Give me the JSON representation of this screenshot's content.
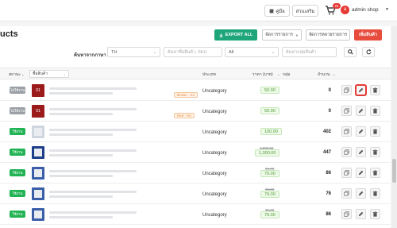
{
  "topbar": {
    "manual_label": "คู่มือ",
    "promo_label": "ส่วนเสริม",
    "cart_count": "24",
    "avatar_letter": "a",
    "user_name": "admin shop"
  },
  "header": {
    "title": "ucts",
    "export_label": "EXPORT ALL",
    "manage_label": "จัดการรายการ",
    "batch_label": "จัดการหลายรายการ",
    "add_label": "เพิ่มสินค้า"
  },
  "filters": {
    "search_label": "ค้นหาจากภาษา",
    "language": "TH",
    "name_placeholder": "ค้นหาชื่อสินค้า, SKU",
    "status": "All",
    "category_placeholder": "ค้นหากลุ่มสินค้า"
  },
  "table": {
    "headers": {
      "status": "สถานะ",
      "name": "ชื่อสินค้า",
      "category": "ประเภท",
      "price": "ราคา (บาท)",
      "group": "กลุ่ม",
      "qty": "จำนวน"
    },
    "rows": [
      {
        "status": "ไม่ใช้งาน",
        "thumb": "01",
        "variant": "Brown - K1",
        "category": "Uncategory",
        "price_old": "",
        "price": "50.00",
        "qty": "0"
      },
      {
        "status": "ไม่ใช้งาน",
        "thumb": "01",
        "variant": "Red - K6",
        "category": "Uncategory",
        "price_old": "",
        "price": "50.00",
        "qty": "0"
      },
      {
        "status": "ใช้งาน",
        "thumb": "",
        "variant": "",
        "category": "Uncategory",
        "price_old": "",
        "price": "100.00",
        "qty": "402"
      },
      {
        "status": "ใช้งาน",
        "thumb": "",
        "variant": "",
        "category": "Uncategory",
        "price_old": "1,200.00",
        "price": "1,000.00",
        "qty": "447"
      },
      {
        "status": "ใช้งาน",
        "thumb": "",
        "variant": "",
        "category": "Uncategory",
        "price_old": "99.00",
        "price": "79.00",
        "qty": "86"
      },
      {
        "status": "ใช้งาน",
        "thumb": "",
        "variant": "",
        "category": "Uncategory",
        "price_old": "99.00",
        "price": "79.00",
        "qty": "76"
      },
      {
        "status": "ใช้งาน",
        "thumb": "",
        "variant": "",
        "category": "Uncategory",
        "price_old": "99.00",
        "price": "79.00",
        "qty": "86"
      }
    ]
  },
  "colors": {
    "active": "#21b354",
    "inactive": "#9aa0a6",
    "export": "#1ea67a",
    "add": "#e74c3c",
    "price_text": "#4c9b2f",
    "highlight": "#e53935"
  }
}
